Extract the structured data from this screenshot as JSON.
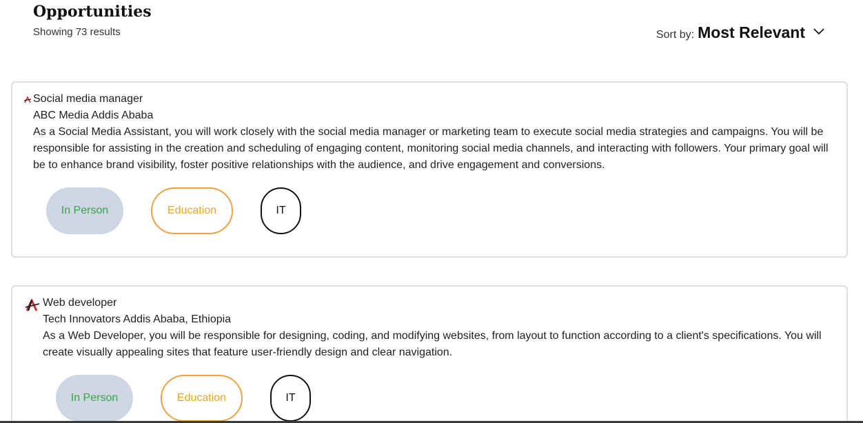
{
  "header": {
    "title": "Opportunities",
    "results_text": "Showing 73 results",
    "sort_label": "Sort by:",
    "sort_value": "Most Relevant",
    "sort_icon": "chevron-down-icon"
  },
  "jobs": [
    {
      "title": "Social media manager",
      "company": "ABC Media Addis Ababa",
      "description": "As a Social Media Assistant, you will work closely with the social media manager or marketing team to execute social media strategies and campaigns. You will be responsible for assisting in the creation and scheduling of engaging content, monitoring social media channels, and interacting with followers. Your primary goal will be to enhance brand visibility, foster positive relationships with the audience, and drive engagement and conversions.",
      "logo_icon": "company-logo-icon",
      "tags": [
        "In Person",
        "Education",
        "IT"
      ]
    },
    {
      "title": "Web developer",
      "company": "Tech Innovators Addis Ababa, Ethiopia",
      "description": "As a Web Developer, you will be responsible for designing, coding, and modifying websites, from layout to function according to a client's specifications. You will create visually appealing sites that feature user-friendly design and clear navigation.",
      "logo_icon": "company-logo-icon",
      "tags": [
        "In Person",
        "Education",
        "IT"
      ]
    }
  ],
  "colors": {
    "tag_mode_bg": "#cdd6e2",
    "tag_mode_text": "#3aa54a",
    "tag_category_border": "#f0a044",
    "tag_category_text": "#e5a720",
    "tag_field_border": "#111111",
    "logo_red": "#d42a2a"
  }
}
